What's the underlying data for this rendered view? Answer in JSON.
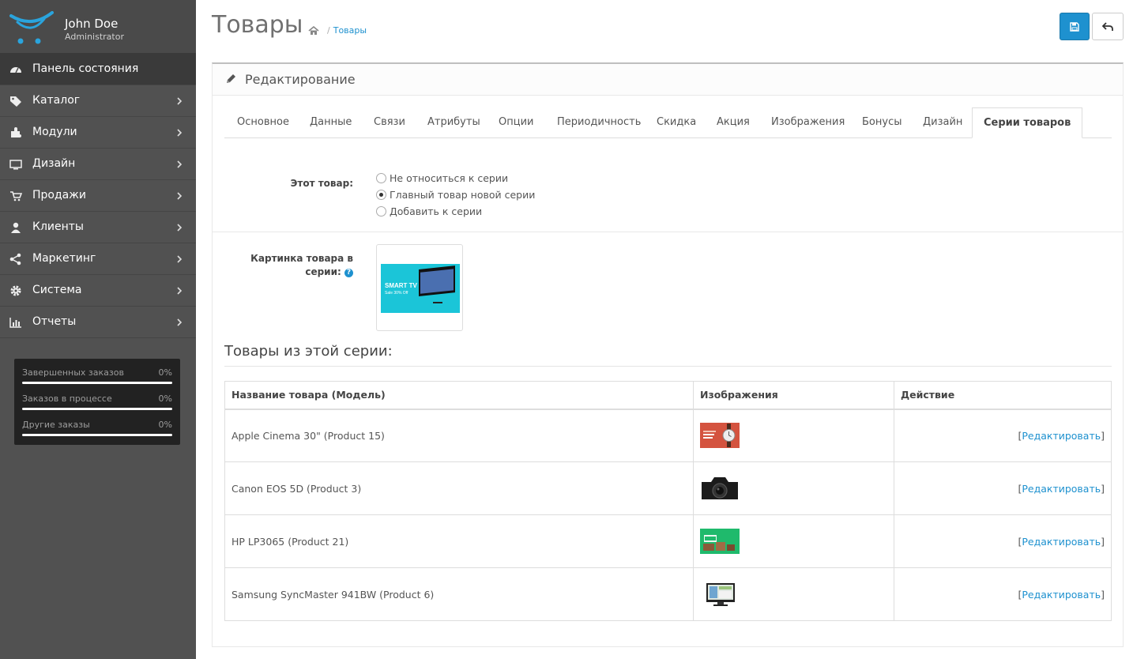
{
  "sidebar": {
    "user_name": "John Doe",
    "user_role": "Administrator",
    "menu": [
      {
        "label": "Панель состояния",
        "icon": "dashboard-icon",
        "active": true
      },
      {
        "label": "Каталог",
        "icon": "tags-icon"
      },
      {
        "label": "Модули",
        "icon": "puzzle-icon"
      },
      {
        "label": "Дизайн",
        "icon": "monitor-icon"
      },
      {
        "label": "Продажи",
        "icon": "cart-icon"
      },
      {
        "label": "Клиенты",
        "icon": "user-icon"
      },
      {
        "label": "Маркетинг",
        "icon": "share-icon"
      },
      {
        "label": "Система",
        "icon": "cog-icon"
      },
      {
        "label": "Отчеты",
        "icon": "bar-chart-icon"
      }
    ],
    "stats": [
      {
        "label": "Завершенных заказов",
        "value": "0%",
        "fraction": 0
      },
      {
        "label": "Заказов в процессе",
        "value": "0%",
        "fraction": 0
      },
      {
        "label": "Другие заказы",
        "value": "0%",
        "fraction": 0
      }
    ]
  },
  "header": {
    "title": "Товары",
    "breadcrumb": {
      "separator": "/",
      "link": "Товары"
    }
  },
  "panel": {
    "heading": "Редактирование",
    "tabs": [
      "Основное",
      "Данные",
      "Связи",
      "Атрибуты",
      "Опции",
      "Периодичность",
      "Скидка",
      "Акция",
      "Изображения",
      "Бонусы",
      "Дизайн",
      "Серии товаров"
    ],
    "active_tab": "Серии товаров",
    "this_product_label": "Этот товар:",
    "radio_options": [
      "Не относиться к серии",
      "Главный товар новой серии",
      "Добавить к серии"
    ],
    "radio_selected": 1,
    "image_label_line1": "Картинка товара в",
    "image_label_line2": "серии:",
    "help_glyph": "?",
    "thumb_text1": "SMART TV",
    "thumb_text2": "Sale 30% Off",
    "series_title": "Товары из этой серии:",
    "table": {
      "headers": [
        "Название товара (Модель)",
        "Изображения",
        "Действие"
      ],
      "rows": [
        {
          "name": "Apple Cinema 30\" (Product 15)",
          "image": "watch-banner",
          "action": "Редактировать"
        },
        {
          "name": "Canon EOS 5D (Product 3)",
          "image": "camera",
          "action": "Редактировать"
        },
        {
          "name": "HP LP3065 (Product 21)",
          "image": "sale-banner",
          "action": "Редактировать"
        },
        {
          "name": "Samsung SyncMaster 941BW (Product 6)",
          "image": "monitor",
          "action": "Редактировать"
        }
      ],
      "bracket_open": "[",
      "bracket_close": "]"
    }
  },
  "colors": {
    "accent": "#1e91cf",
    "sidebar": "#515151",
    "stats_bg": "#222222"
  }
}
